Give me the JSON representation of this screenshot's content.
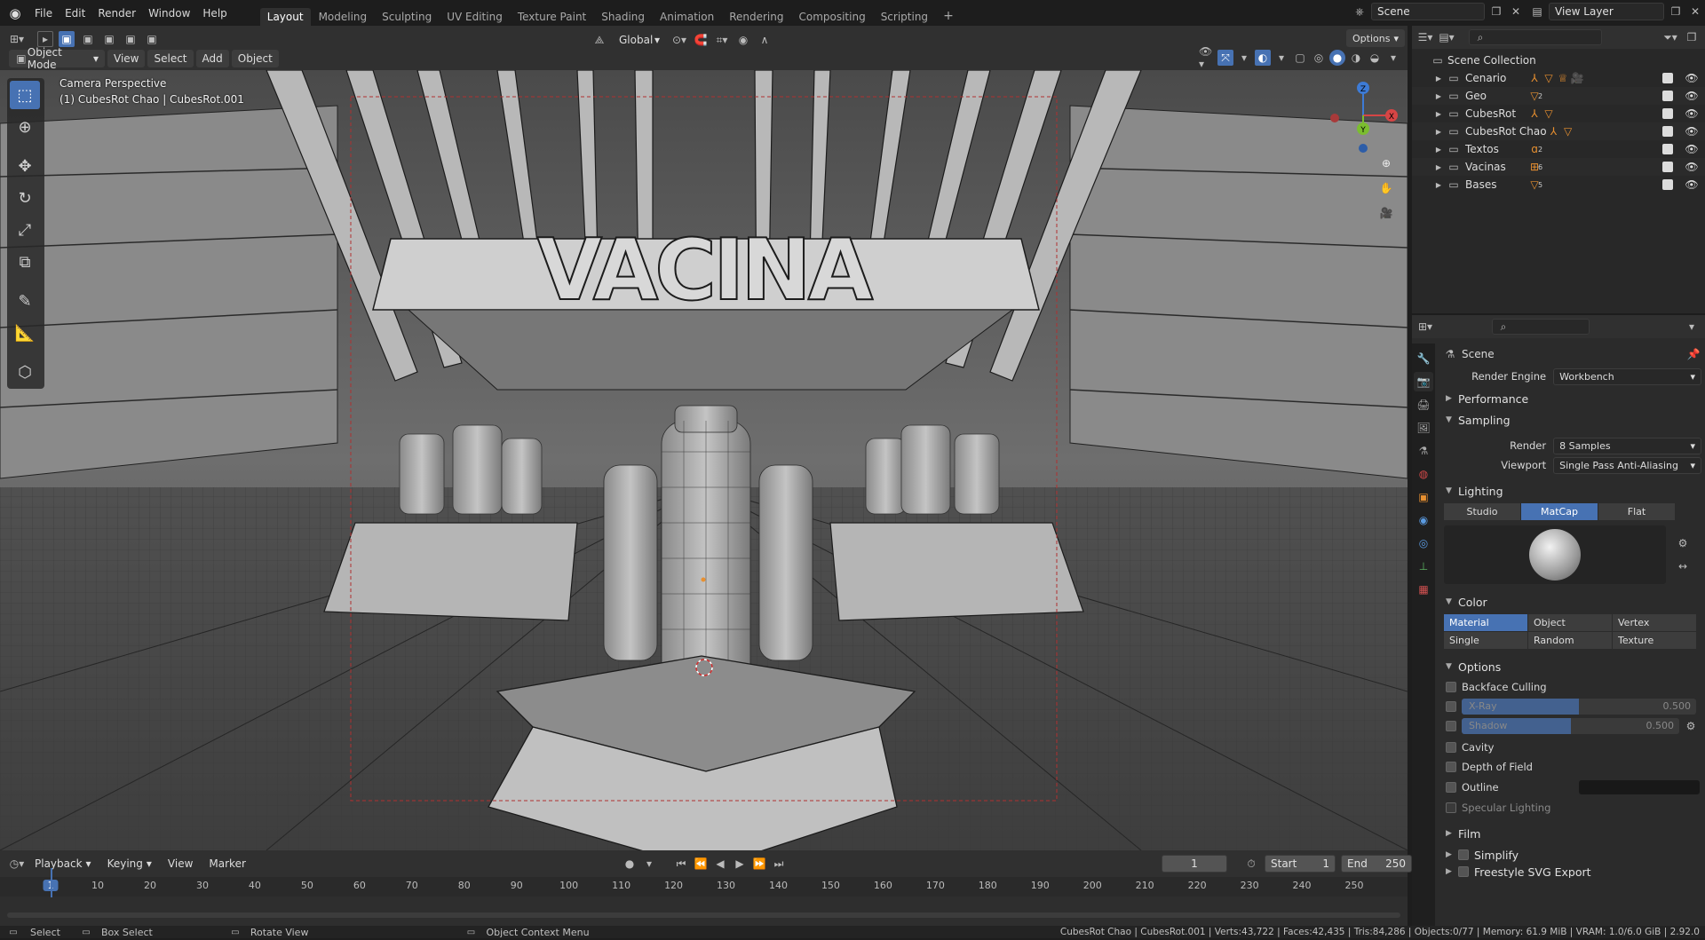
{
  "topbar": {
    "menus": [
      "File",
      "Edit",
      "Render",
      "Window",
      "Help"
    ],
    "tabs": [
      "Layout",
      "Modeling",
      "Sculpting",
      "UV Editing",
      "Texture Paint",
      "Shading",
      "Animation",
      "Rendering",
      "Compositing",
      "Scripting"
    ],
    "active_tab": "Layout",
    "scene_name": "Scene",
    "view_layer": "View Layer"
  },
  "viewport_header": {
    "mode": "Object Mode",
    "menus": [
      "View",
      "Select",
      "Add",
      "Object"
    ],
    "orientation": "Global",
    "options": "Options"
  },
  "viewport": {
    "camera_label": "Camera Perspective",
    "object_label": "(1) CubesRot Chao | CubesRot.001"
  },
  "outliner": {
    "root": "Scene Collection",
    "collections": [
      {
        "name": "Cenario",
        "badge": ""
      },
      {
        "name": "Geo",
        "badge": "2"
      },
      {
        "name": "CubesRot",
        "badge": ""
      },
      {
        "name": "CubesRot Chao",
        "badge": ""
      },
      {
        "name": "Textos",
        "badge": "2"
      },
      {
        "name": "Vacinas",
        "badge": "6"
      },
      {
        "name": "Bases",
        "badge": "5"
      }
    ]
  },
  "properties": {
    "context": "Scene",
    "render_engine_label": "Render Engine",
    "render_engine": "Workbench",
    "sections": {
      "performance": "Performance",
      "sampling": "Sampling",
      "lighting": "Lighting",
      "color": "Color",
      "options": "Options",
      "film": "Film",
      "freestyle": "Freestyle SVG Export"
    },
    "render_label": "Render",
    "render_samples": "8 Samples",
    "viewport_label": "Viewport",
    "viewport_aa": "Single Pass Anti-Aliasing",
    "lighting_modes": [
      "Studio",
      "MatCap",
      "Flat"
    ],
    "lighting_active": "MatCap",
    "color_modes": [
      "Material",
      "Object",
      "Vertex",
      "Single",
      "Random",
      "Texture"
    ],
    "color_active": "Material",
    "backface_culling": "Backface Culling",
    "xray_label": "X-Ray",
    "xray_value": "0.500",
    "xray_fraction": 0.5,
    "shadow_label": "Shadow",
    "shadow_value": "0.500",
    "shadow_fraction": 0.5,
    "cavity": "Cavity",
    "depth_of_field": "Depth of Field",
    "outline": "Outline",
    "specular": "Specular Lighting",
    "simplify": "Simplify"
  },
  "timeline": {
    "menus": [
      "Playback",
      "Keying",
      "View",
      "Marker"
    ],
    "current_frame": "1",
    "start_label": "Start",
    "start": "1",
    "end_label": "End",
    "end": "250",
    "ticks": [
      "1",
      "10",
      "20",
      "30",
      "40",
      "50",
      "60",
      "70",
      "80",
      "90",
      "100",
      "110",
      "120",
      "130",
      "140",
      "150",
      "160",
      "170",
      "180",
      "190",
      "200",
      "210",
      "220",
      "230",
      "240",
      "250"
    ]
  },
  "statusbar": {
    "select": "Select",
    "box_select": "Box Select",
    "rotate": "Rotate View",
    "context_menu": "Object Context Menu",
    "stats": "CubesRot Chao | CubesRot.001 | Verts:43,722 | Faces:42,435 | Tris:84,286 | Objects:0/77 | Memory: 61.9 MiB | VRAM: 1.0/6.0 GiB | 2.92.0"
  },
  "colors": {
    "accent": "#4772b3",
    "bg": "#1d1d1d",
    "panel": "#2b2b2b",
    "header": "#303030",
    "playhead": "#4772b3"
  }
}
